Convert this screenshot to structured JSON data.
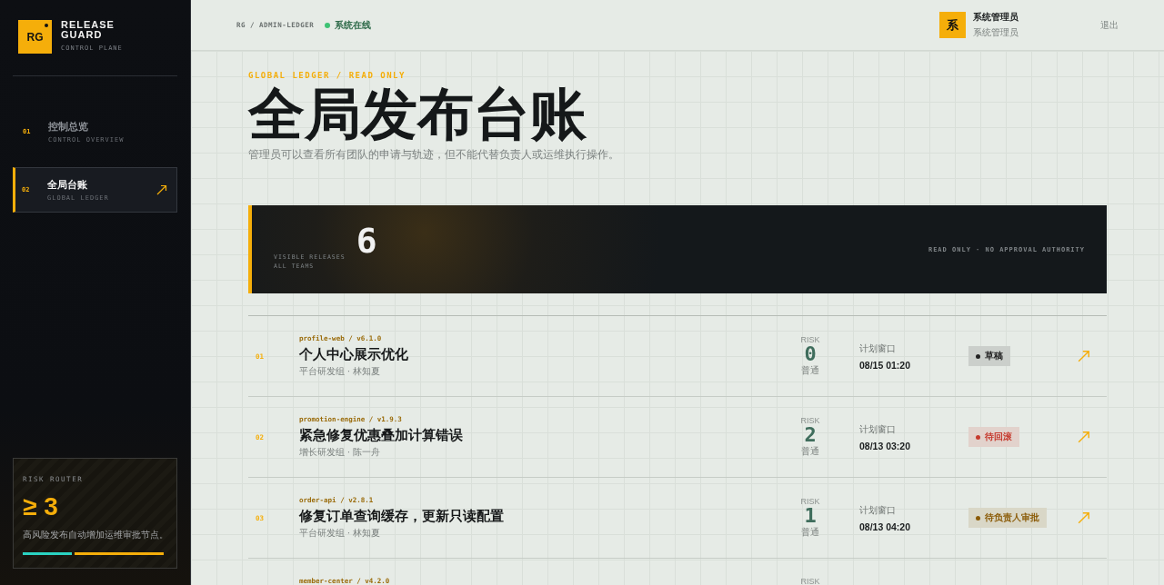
{
  "brand": {
    "mark": "RG",
    "name_line1": "RELEASE",
    "name_line2": "GUARD",
    "subtitle": "CONTROL PLANE"
  },
  "nav": [
    {
      "index": "01",
      "label": "控制总览",
      "sublabel": "CONTROL OVERVIEW",
      "selected": false
    },
    {
      "index": "02",
      "label": "全局台账",
      "sublabel": "GLOBAL LEDGER",
      "selected": true
    }
  ],
  "risk_router": {
    "label": "RISK ROUTER",
    "threshold": "≥ 3",
    "description": "高风险发布自动增加运维审批节点。",
    "level": 0.35
  },
  "header": {
    "breadcrumb": "RG / ADMIN-LEDGER",
    "status": "系统在线",
    "user_avatar": "系",
    "user_name": "系统管理员",
    "user_role": "系统管理员",
    "logout": "退出"
  },
  "page": {
    "eyebrow": "GLOBAL LEDGER / READ ONLY",
    "title": "全局发布台账",
    "description": "管理员可以查看所有团队的申请与轨迹，但不能代替负责人或运维执行操作。"
  },
  "summary": {
    "label_line1": "VISIBLE RELEASES",
    "label_line2": "ALL TEAMS",
    "count": "6",
    "note": "READ ONLY · NO APPROVAL AUTHORITY"
  },
  "releases": [
    {
      "index": "01",
      "repo": "profile-web / v6.1.0",
      "title": "个人中心展示优化",
      "owner": "平台研发组 · 林知夏",
      "risk_label": "RISK",
      "risk": "0",
      "risk_level": "普通",
      "window_label": "计划窗口",
      "window": "08/15 01:20",
      "status": "草稿",
      "color": "#222222"
    },
    {
      "index": "02",
      "repo": "promotion-engine / v1.9.3",
      "title": "紧急修复优惠叠加计算错误",
      "owner": "增长研发组 · 陈一舟",
      "risk_label": "RISK",
      "risk": "2",
      "risk_level": "普通",
      "window_label": "计划窗口",
      "window": "08/13 03:20",
      "status": "待回滚",
      "color": "#c63a2e"
    },
    {
      "index": "03",
      "repo": "order-api / v2.8.1",
      "title": "修复订单查询缓存，更新只读配置",
      "owner": "平台研发组 · 林知夏",
      "risk_label": "RISK",
      "risk": "1",
      "risk_level": "普通",
      "window_label": "计划窗口",
      "window": "08/13 04:20",
      "status": "待负责人审批",
      "color": "#8a5a06"
    },
    {
      "repo": "member-center / v4.2.0",
      "risk_label": "RISK"
    }
  ]
}
